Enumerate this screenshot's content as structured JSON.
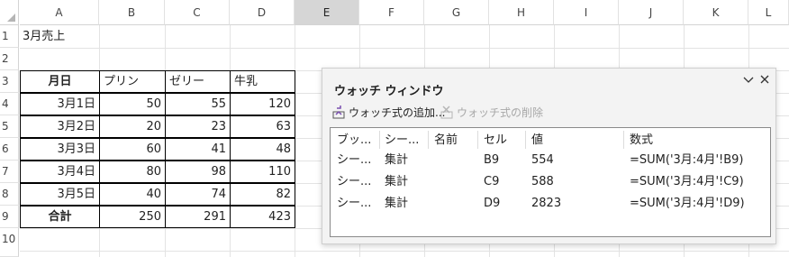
{
  "columns": [
    "A",
    "B",
    "C",
    "D",
    "E",
    "F",
    "G",
    "H",
    "I",
    "J",
    "K",
    "L"
  ],
  "selected_column": "E",
  "rows": [
    "1",
    "2",
    "3",
    "4",
    "5",
    "6",
    "7",
    "8",
    "9",
    "10"
  ],
  "title_cell": "3月売上",
  "table": {
    "headers": [
      "月日",
      "プリン",
      "ゼリー",
      "牛乳"
    ],
    "rows": [
      [
        "3月1日",
        "50",
        "55",
        "120"
      ],
      [
        "3月2日",
        "20",
        "23",
        "63"
      ],
      [
        "3月3日",
        "60",
        "41",
        "48"
      ],
      [
        "3月4日",
        "80",
        "98",
        "110"
      ],
      [
        "3月5日",
        "40",
        "74",
        "82"
      ]
    ],
    "total": [
      "合計",
      "250",
      "291",
      "423"
    ]
  },
  "watch_window": {
    "title": "ウォッチ ウィンドウ",
    "add_label": "ウォッチ式の追加...",
    "delete_label": "ウォッチ式の削除",
    "columns": [
      "ブッ...",
      "シー...",
      "名前",
      "セル",
      "値",
      "数式"
    ],
    "rows": [
      [
        "シー...",
        "集計",
        "",
        "B9",
        "554",
        "=SUM('3月:4月'!B9)"
      ],
      [
        "シー...",
        "集計",
        "",
        "C9",
        "588",
        "=SUM('3月:4月'!C9)"
      ],
      [
        "シー...",
        "集計",
        "",
        "D9",
        "2823",
        "=SUM('3月:4月'!D9)"
      ]
    ],
    "icons": {
      "collapse": "chevron-down-icon",
      "close": "close-icon",
      "add": "add-watch-icon",
      "delete": "delete-watch-icon"
    }
  }
}
